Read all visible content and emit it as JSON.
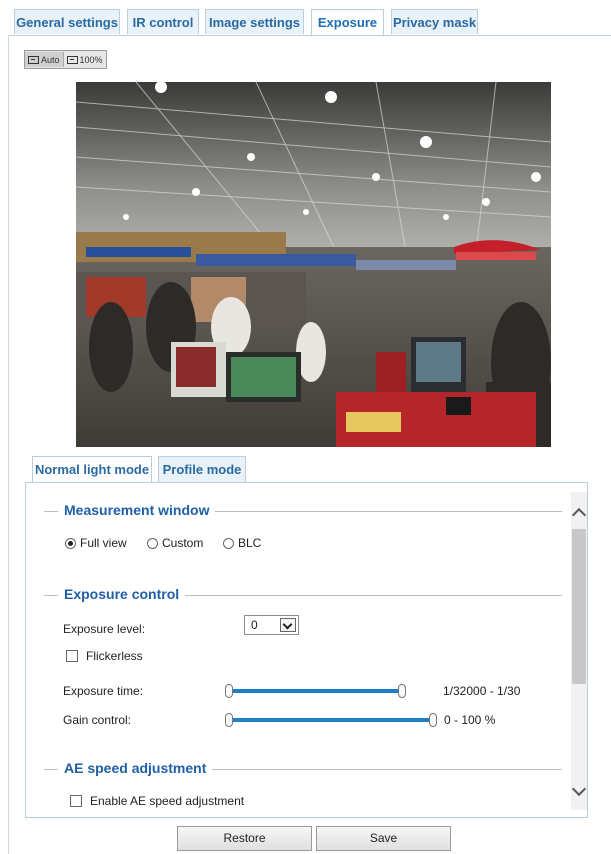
{
  "top_tabs": [
    {
      "label": "General settings",
      "active": false
    },
    {
      "label": "IR control",
      "active": false
    },
    {
      "label": "Image settings",
      "active": false
    },
    {
      "label": "Exposure",
      "active": true
    },
    {
      "label": "Privacy mask",
      "active": false
    }
  ],
  "view": {
    "auto_label": "Auto",
    "full_label": "100%"
  },
  "sub_tabs": [
    {
      "label": "Normal light mode",
      "active": true
    },
    {
      "label": "Profile mode",
      "active": false
    }
  ],
  "measurement": {
    "title": "Measurement window",
    "options": [
      "Full view",
      "Custom",
      "BLC"
    ],
    "selected": "Full view"
  },
  "exposure": {
    "title": "Exposure control",
    "level_label": "Exposure level:",
    "level_value": "0",
    "flickerless_label": "Flickerless",
    "flickerless_checked": false,
    "time_label": "Exposure time:",
    "time_range": "1/32000 - 1/30",
    "time_min_fraction": 0.0,
    "time_max_fraction": 1.0,
    "gain_label": "Gain control:",
    "gain_range": "0 - 100 %",
    "gain_min_fraction": 0.0,
    "gain_max_fraction": 1.0
  },
  "ae": {
    "title": "AE speed adjustment",
    "enable_label": "Enable AE speed adjustment",
    "enable_checked": false
  },
  "buttons": {
    "restore": "Restore",
    "save": "Save"
  },
  "colors": {
    "accent": "#1d7fc6",
    "tab_text": "#2a6aa3",
    "section_title": "#1f5fa8"
  }
}
